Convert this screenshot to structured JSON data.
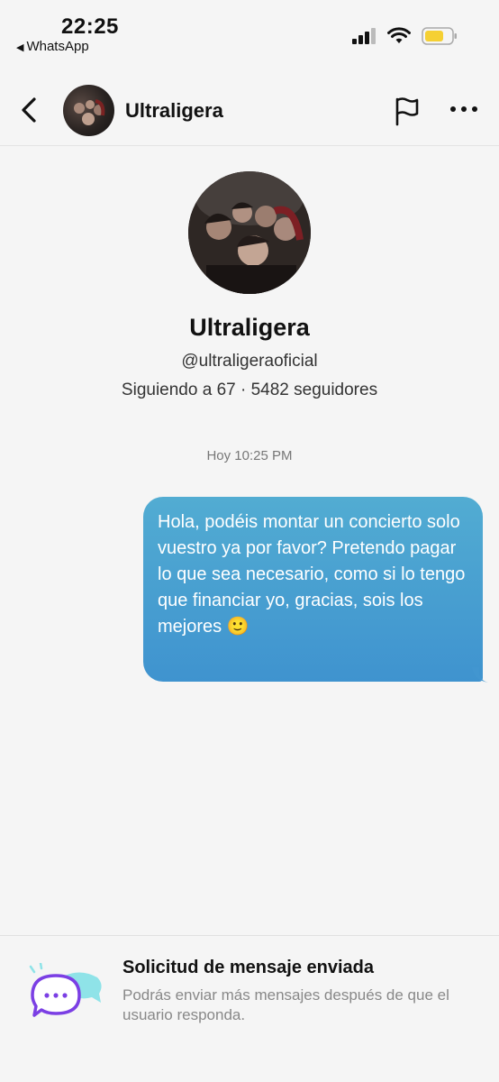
{
  "status_bar": {
    "time": "22:25",
    "back_app": "WhatsApp",
    "battery_color": "#f5d033"
  },
  "navbar": {
    "title": "Ultraligera",
    "back_icon": "chevron-left-icon",
    "report_icon": "flag-icon",
    "more_icon": "more-horizontal-icon"
  },
  "profile": {
    "name": "Ultraligera",
    "handle": "@ultraligeraoficial",
    "stats": "Siguiendo a 67 · 5482 seguidores"
  },
  "chat": {
    "timestamp": "Hoy 10:25 PM",
    "messages": [
      {
        "text": "Hola, podéis montar un concierto solo vuestro ya por favor? Pretendo pagar lo que sea necesario, como si lo tengo que financiar yo, gracias, sois los mejores 🙂",
        "from": "me",
        "bubble_color": "#4aa3d1"
      }
    ]
  },
  "footer": {
    "title": "Solicitud de mensaje enviada",
    "subtitle": "Podrás enviar más mensajes después de que el usuario responda.",
    "icon": "chat-bubbles-icon"
  }
}
